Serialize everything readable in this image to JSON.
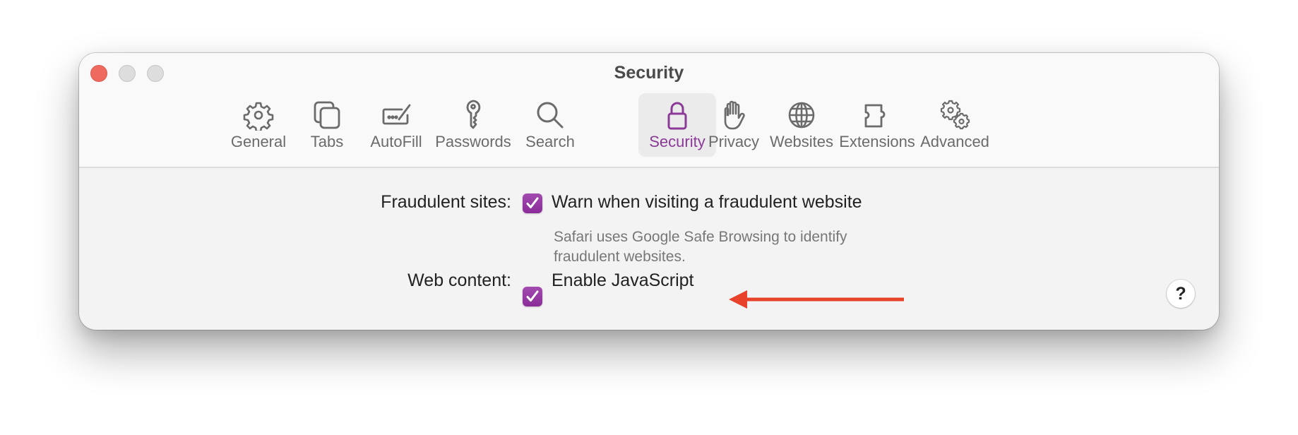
{
  "window": {
    "title": "Security",
    "controls": {
      "close": "close",
      "minimize": "minimize",
      "zoom": "zoom"
    }
  },
  "toolbar": {
    "selected": "Security",
    "accent_color": "#8b3a97",
    "tabs": [
      {
        "label": "General",
        "icon": "gear-icon"
      },
      {
        "label": "Tabs",
        "icon": "tabs-icon"
      },
      {
        "label": "AutoFill",
        "icon": "autofill-icon"
      },
      {
        "label": "Passwords",
        "icon": "key-icon"
      },
      {
        "label": "Search",
        "icon": "search-icon"
      },
      {
        "label": "Security",
        "icon": "lock-icon"
      },
      {
        "label": "Privacy",
        "icon": "hand-icon"
      },
      {
        "label": "Websites",
        "icon": "globe-icon"
      },
      {
        "label": "Extensions",
        "icon": "puzzle-icon"
      },
      {
        "label": "Advanced",
        "icon": "gears-icon"
      }
    ]
  },
  "settings": {
    "fraudulent": {
      "label": "Fraudulent sites:",
      "option": "Warn when visiting a fraudulent website",
      "checked": true,
      "description": "Safari uses Google Safe Browsing to identify fraudulent websites."
    },
    "web_content": {
      "label": "Web content:",
      "option": "Enable JavaScript",
      "checked": true
    }
  },
  "help_button": {
    "label": "?"
  },
  "annotation": {
    "type": "arrow",
    "points_to": "Enable JavaScript",
    "color": "#e8422b"
  }
}
